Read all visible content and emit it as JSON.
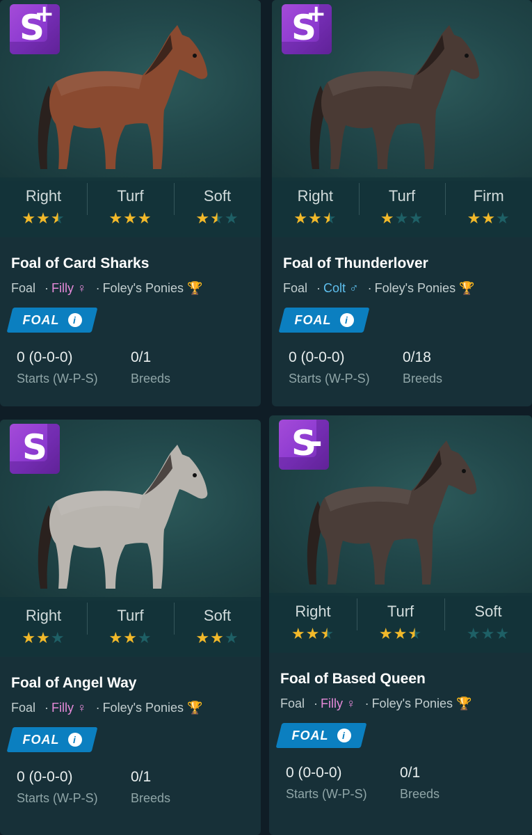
{
  "cards": [
    {
      "grade": "S",
      "grade_mod": "+",
      "stats": [
        {
          "label": "Right",
          "stars": 2.5
        },
        {
          "label": "Turf",
          "stars": 3
        },
        {
          "label": "Soft",
          "stars": 1.5
        }
      ],
      "name": "Foal of Card Sharks",
      "age": "Foal",
      "sex": "Filly",
      "sex_symbol": "♀",
      "owner": "Foley's Ponies",
      "badge": "FOAL",
      "record": "0 (0-0-0)",
      "record_label": "Starts (W-P-S)",
      "breeds": "0/1",
      "breeds_label": "Breeds",
      "coat": "#8a4a30"
    },
    {
      "grade": "S",
      "grade_mod": "+",
      "stats": [
        {
          "label": "Right",
          "stars": 2.5
        },
        {
          "label": "Turf",
          "stars": 1
        },
        {
          "label": "Firm",
          "stars": 2
        }
      ],
      "name": "Foal of Thunderlover",
      "age": "Foal",
      "sex": "Colt",
      "sex_symbol": "♂",
      "owner": "Foley's Ponies",
      "badge": "FOAL",
      "record": "0 (0-0-0)",
      "record_label": "Starts (W-P-S)",
      "breeds": "0/18",
      "breeds_label": "Breeds",
      "coat": "#4a3a34"
    },
    {
      "grade": "S",
      "grade_mod": "",
      "stats": [
        {
          "label": "Right",
          "stars": 2
        },
        {
          "label": "Turf",
          "stars": 2
        },
        {
          "label": "Soft",
          "stars": 2
        }
      ],
      "name": "Foal of Angel Way",
      "age": "Foal",
      "sex": "Filly",
      "sex_symbol": "♀",
      "owner": "Foley's Ponies",
      "badge": "FOAL",
      "record": "0 (0-0-0)",
      "record_label": "Starts (W-P-S)",
      "breeds": "0/1",
      "breeds_label": "Breeds",
      "coat": "#b8b4ae"
    },
    {
      "grade": "S",
      "grade_mod": "-",
      "stats": [
        {
          "label": "Right",
          "stars": 2.5
        },
        {
          "label": "Turf",
          "stars": 2.5
        },
        {
          "label": "Soft",
          "stars": 0
        }
      ],
      "name": "Foal of Based Queen",
      "age": "Foal",
      "sex": "Filly",
      "sex_symbol": "♀",
      "owner": "Foley's Ponies",
      "badge": "FOAL",
      "record": "0 (0-0-0)",
      "record_label": "Starts (W-P-S)",
      "breeds": "0/1",
      "breeds_label": "Breeds",
      "coat": "#4a3d38"
    }
  ]
}
